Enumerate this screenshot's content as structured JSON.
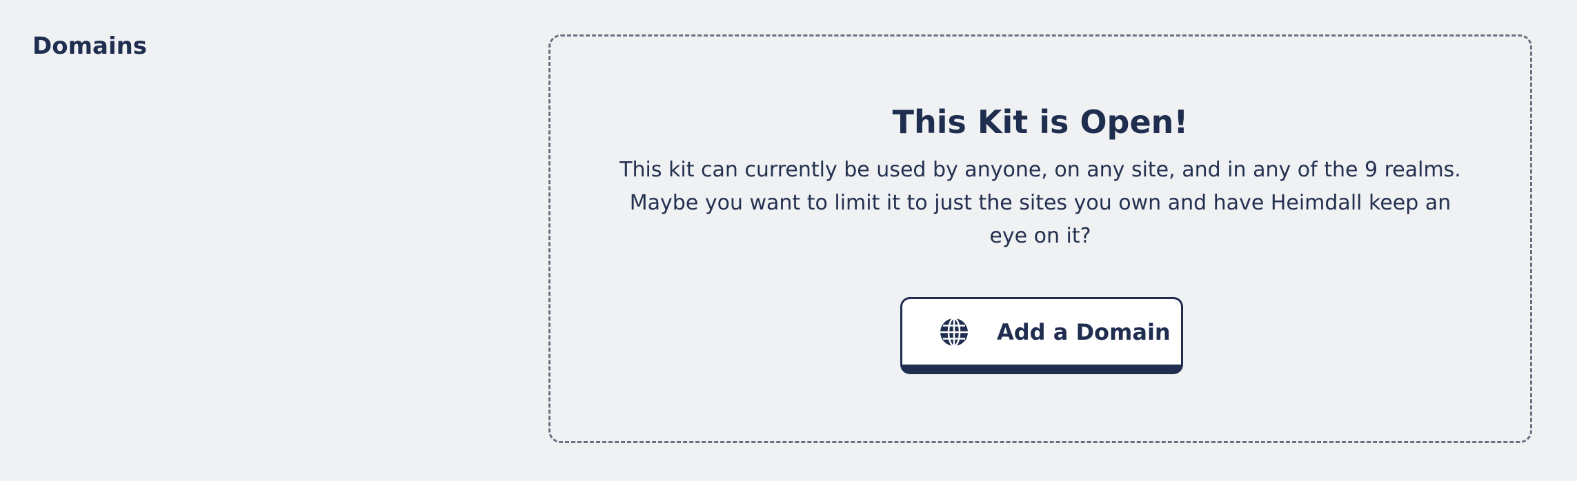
{
  "section": {
    "title": "Domains"
  },
  "empty_state": {
    "heading": "This Kit is Open!",
    "description": "This kit can currently be used by anyone, on any site, and in any of the 9 realms. Maybe you want to limit it to just the sites you own and have Heimdall keep an eye on it?",
    "button": {
      "label": "Add a Domain",
      "icon": "globe-icon"
    }
  },
  "colors": {
    "background": "#eff1f3",
    "text": "#1f2d4f",
    "dashed_border": "#6b6d80",
    "button_background": "#ffffff"
  }
}
